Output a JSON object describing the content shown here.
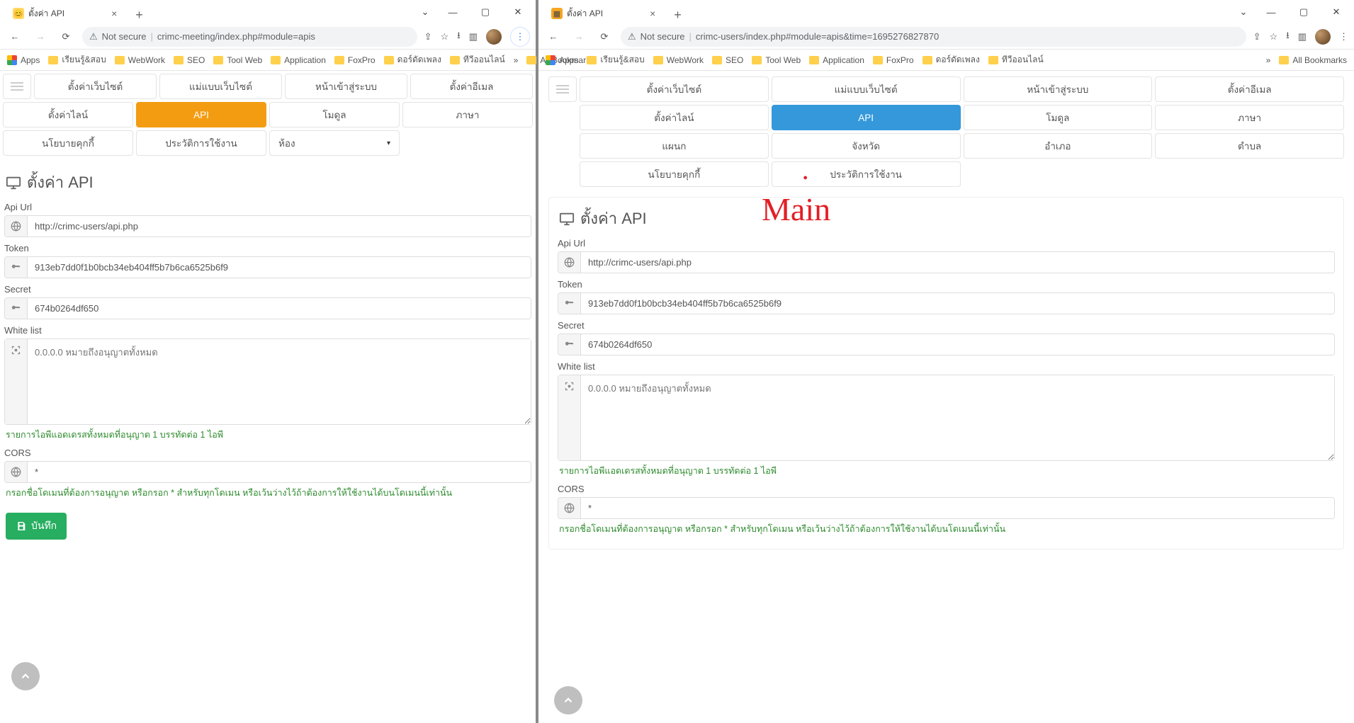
{
  "left": {
    "tab_title": "ตั้งค่า API",
    "url_warn": "Not secure",
    "url_path": "crimc-meeting/index.php#module=apis",
    "bookmarks": [
      "Apps",
      "เรียนรู้&สอบ",
      "WebWork",
      "SEO",
      "Tool Web",
      "Application",
      "FoxPro",
      "ดอร์ดัดเพลง",
      "ทีวีออนไลน์"
    ],
    "bookmarks_all": "All Bookmarks",
    "tabs": [
      "ตั้งค่าเว็บไซต์",
      "แม่แบบเว็บไซต์",
      "หน้าเข้าสู่ระบบ",
      "ตั้งค่าอีเมล",
      "ตั้งค่าไลน์",
      "API",
      "โมดูล",
      "ภาษา",
      "นโยบายคุกกี้",
      "ประวัติการใช้งาน"
    ],
    "room_select": "ห้อง",
    "page_heading": "ตั้งค่า API",
    "labels": {
      "api_url": "Api Url",
      "token": "Token",
      "secret": "Secret",
      "whitelist": "White list",
      "cors": "CORS"
    },
    "values": {
      "api_url": "http://crimc-users/api.php",
      "token": "913eb7dd0f1b0bcb34eb404ff5b7b6ca6525b6f9",
      "secret": "674b0264df650",
      "whitelist_placeholder": "0.0.0.0 หมายถึงอนุญาตทั้งหมด",
      "cors": "*"
    },
    "hints": {
      "whitelist": "รายการไอพีแอดเดรสทั้งหมดที่อนุญาต 1 บรรทัดต่อ 1 ไอพี",
      "cors": "กรอกชื่อโดเมนที่ต้องการอนุญาต หรือกรอก * สำหรับทุกโดเมน หรือเว้นว่างไว้ถ้าต้องการให้ใช้งานได้บนโดเมนนี้เท่านั้น"
    },
    "save_label": "บันทึก"
  },
  "right": {
    "tab_title": "ตั้งค่า API",
    "url_warn": "Not secure",
    "url_path": "crimc-users/index.php#module=apis&time=1695276827870",
    "bookmarks": [
      "Apps",
      "เรียนรู้&สอบ",
      "WebWork",
      "SEO",
      "Tool Web",
      "Application",
      "FoxPro",
      "ดอร์ดัดเพลง",
      "ทีวีออนไลน์"
    ],
    "bookmarks_all": "All Bookmarks",
    "tabs": [
      "ตั้งค่าเว็บไซต์",
      "แม่แบบเว็บไซต์",
      "หน้าเข้าสู่ระบบ",
      "ตั้งค่าอีเมล",
      "ตั้งค่าไลน์",
      "API",
      "โมดูล",
      "ภาษา",
      "แผนก",
      "จังหวัด",
      "อำเภอ",
      "ตำบล",
      "นโยบายคุกกี้",
      "ประวัติการใช้งาน"
    ],
    "page_heading": "ตั้งค่า API",
    "labels": {
      "api_url": "Api Url",
      "token": "Token",
      "secret": "Secret",
      "whitelist": "White list",
      "cors": "CORS"
    },
    "values": {
      "api_url": "http://crimc-users/api.php",
      "token": "913eb7dd0f1b0bcb34eb404ff5b7b6ca6525b6f9",
      "secret": "674b0264df650",
      "whitelist_placeholder": "0.0.0.0 หมายถึงอนุญาตทั้งหมด",
      "cors": "*"
    },
    "hints": {
      "whitelist": "รายการไอพีแอดเดรสทั้งหมดที่อนุญาต 1 บรรทัดต่อ 1 ไอพี",
      "cors": "กรอกชื่อโดเมนที่ต้องการอนุญาต หรือกรอก * สำหรับทุกโดเมน หรือเว้นว่างไว้ถ้าต้องการให้ใช้งานได้บนโดเมนนี้เท่านั้น"
    },
    "annotation": "Main"
  }
}
